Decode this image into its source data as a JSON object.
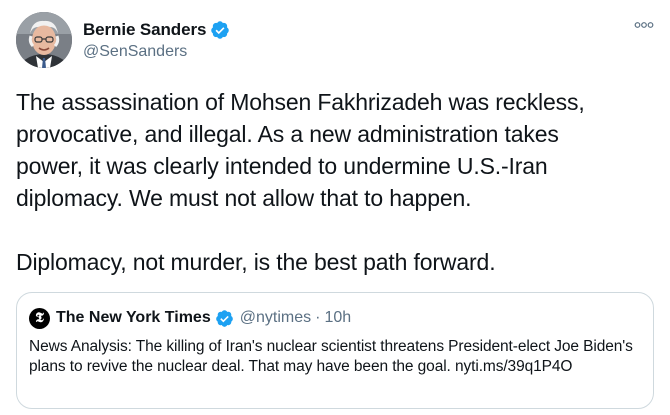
{
  "author": {
    "display_name": "Bernie Sanders",
    "handle": "@SenSanders",
    "verified": true,
    "avatar_icon": "profile-photo"
  },
  "more_icon": "ooo",
  "tweet": {
    "text": "The assassination of Mohsen Fakhrizadeh was reckless,\nprovocative, and illegal. As a new administration takes\npower, it was clearly intended to undermine U.S.-Iran\ndiplomacy. We must not allow that to happen.\n\nDiplomacy, not murder, is the best path forward."
  },
  "quoted_tweet": {
    "avatar_glyph": "𝕿",
    "display_name": "The New York Times",
    "verified": true,
    "handle": "@nytimes",
    "separator": "·",
    "time": "10h",
    "text": "News Analysis: The killing of Iran's nuclear scientist threatens President-elect Joe Biden's plans to revive the nuclear deal. That may have been the goal. nyti.ms/39q1P4O"
  },
  "colors": {
    "verified_badge": "#1da1f2",
    "secondary_text": "#5b7083",
    "border": "#cfd9de"
  }
}
